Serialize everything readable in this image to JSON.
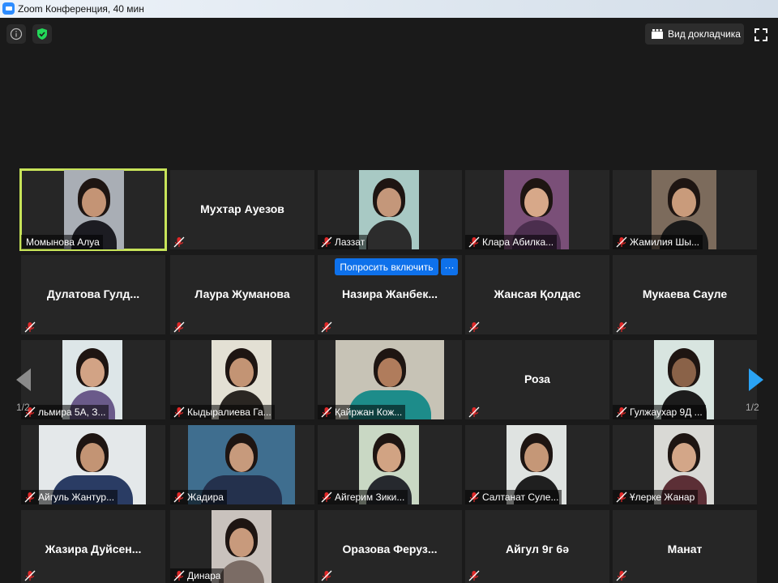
{
  "window": {
    "title": "Zoom Конференция, 40 мин"
  },
  "toolbar": {
    "speaker_view_label": "Вид докладчика"
  },
  "grid": {
    "rows": [
      [
        {
          "name": "Момынова Алуа",
          "video": true
        },
        {
          "name": "Мухтар Ауезов",
          "video": false
        },
        {
          "name": "Лаззат",
          "video": true
        },
        {
          "name": "Клара Абилка...",
          "video": true
        },
        {
          "name": "Жамилия Шы...",
          "video": true
        }
      ],
      [
        {
          "name": "Дулатова  Гулд...",
          "video": false
        },
        {
          "name": "Лаура Жуманова",
          "video": false
        },
        {
          "name": "Назира  Жанбек...",
          "video": false
        },
        {
          "name": "Жансая Қолдас",
          "video": false
        },
        {
          "name": "Мукаева Сауле",
          "video": false
        }
      ],
      [
        {
          "name": "льмира 5А, З...",
          "video": true
        },
        {
          "name": "Кыдыралиева Га...",
          "video": true
        },
        {
          "name": "Қайржан Кож...",
          "video": true
        },
        {
          "name": "Роза",
          "video": false
        },
        {
          "name": "Гулжаухар 9Д ...",
          "video": true
        }
      ],
      [
        {
          "name": "Айгуль Жантур...",
          "video": true
        },
        {
          "name": "Жадира",
          "video": true
        },
        {
          "name": "Айгерим Зики...",
          "video": true
        },
        {
          "name": "Салтанат Суле...",
          "video": true
        },
        {
          "name": "Ұлерке Жанар",
          "video": true
        }
      ],
      [
        {
          "name": "Жазира  Дуйсен...",
          "video": false
        },
        {
          "name": "Динара",
          "video": true
        },
        {
          "name": "Оразова  Феруз...",
          "video": false
        },
        {
          "name": "Айгул 9г 6ә",
          "video": false
        },
        {
          "name": "Манат",
          "video": false
        }
      ]
    ],
    "hover_actions": {
      "ask_unmute_label": "Попросить включить",
      "more_label": "···"
    }
  },
  "pagination": {
    "left_indicator": "1/2",
    "right_indicator": "1/2"
  },
  "icons": {
    "info": "info-icon",
    "security": "shield-check-icon",
    "speaker_view": "grid-icon",
    "fullscreen": "fullscreen-icon",
    "muted": "mic-muted-icon",
    "prev": "chevron-left-icon",
    "next": "chevron-right-icon"
  },
  "colors": {
    "active_speaker": "#c7e359",
    "accent": "#0e71eb",
    "muted": "#e02828",
    "security": "#23d959"
  }
}
